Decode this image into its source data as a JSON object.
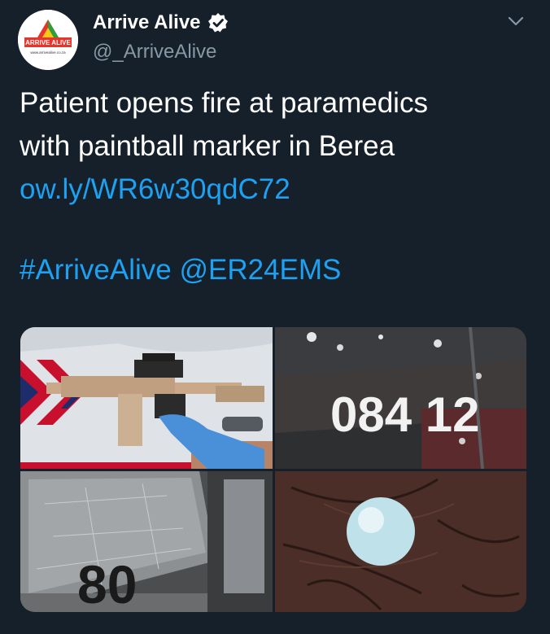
{
  "tweet": {
    "author": {
      "display_name": "Arrive Alive",
      "handle": "@_ArriveAlive",
      "verified": true,
      "avatar_icon": "arrive-alive-logo",
      "avatar_text": "ARRIVE ALIVE",
      "avatar_url_text": "www.arrivealive.co.za"
    },
    "text_lines": [
      "Patient opens fire at paramedics",
      "with paintball marker in Berea"
    ],
    "link": "ow.ly/WR6w30qdC72",
    "hashtag": "#ArriveAlive",
    "mention": "@ER24EMS",
    "menu_icon": "chevron-down-icon",
    "media": {
      "photos": [
        {
          "name": "paintball-marker-photo"
        },
        {
          "name": "ambulance-number-photo",
          "overlay_text": "084 12"
        },
        {
          "name": "shattered-window-photo",
          "overlay_text": "80"
        },
        {
          "name": "paintball-in-hand-photo"
        }
      ]
    }
  },
  "colors": {
    "background": "#15202b",
    "text": "#ffffff",
    "secondary_text": "#8899a6",
    "link": "#1da1f2"
  }
}
